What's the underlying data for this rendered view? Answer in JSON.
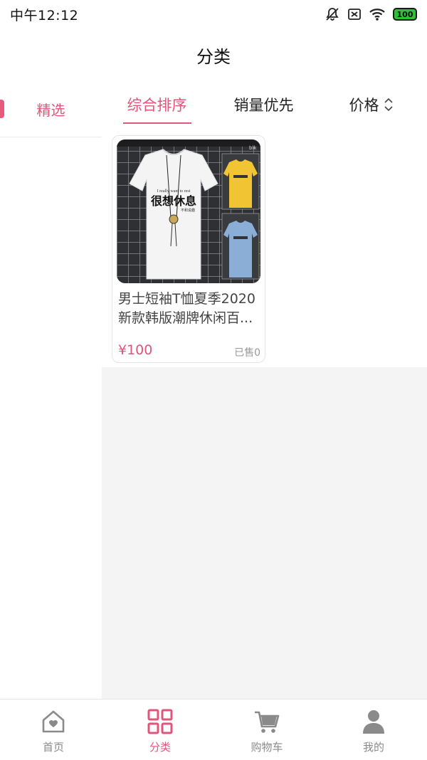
{
  "status_bar": {
    "time": "中午12:12",
    "battery": "100",
    "icons": [
      "mute-bell-icon",
      "sim-off-icon",
      "wifi-icon",
      "battery-icon"
    ]
  },
  "header": {
    "title": "分类"
  },
  "sidebar": {
    "items": [
      {
        "label": "精选",
        "selected": true
      }
    ]
  },
  "sort_bar": {
    "tabs": [
      {
        "label": "综合排序",
        "active": true
      },
      {
        "label": "销量优先",
        "active": false
      },
      {
        "label": "价格",
        "active": false,
        "icon": "sort-chevrons-icon"
      }
    ]
  },
  "products": [
    {
      "name": "男士短袖T恤夏季2020新款韩版潮牌休闲百...",
      "price": "¥100",
      "sold": "已售0",
      "image_text": {
        "main": "很想休息",
        "sub": "I really want to rest",
        "small": "不和说趣"
      }
    }
  ],
  "tab_bar": {
    "items": [
      {
        "label": "首页",
        "icon": "home-icon",
        "active": false
      },
      {
        "label": "分类",
        "icon": "category-grid-icon",
        "active": true
      },
      {
        "label": "购物车",
        "icon": "cart-icon",
        "active": false
      },
      {
        "label": "我的",
        "icon": "user-icon",
        "active": false
      }
    ]
  },
  "colors": {
    "accent": "#e0557a",
    "background": "#f4f4f5",
    "battery": "#2fbf3a"
  }
}
